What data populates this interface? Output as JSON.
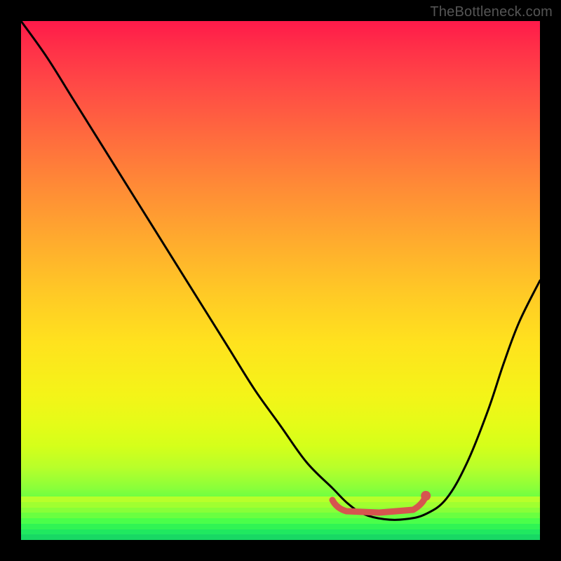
{
  "watermark": "TheBottleneck.com",
  "chart_data": {
    "type": "line",
    "title": "",
    "xlabel": "",
    "ylabel": "",
    "xlim": [
      0,
      1
    ],
    "ylim": [
      0,
      1
    ],
    "series": [
      {
        "name": "bottleneck-curve",
        "x": [
          0.0,
          0.05,
          0.1,
          0.15,
          0.2,
          0.25,
          0.3,
          0.35,
          0.4,
          0.45,
          0.5,
          0.55,
          0.6,
          0.63,
          0.66,
          0.7,
          0.74,
          0.78,
          0.82,
          0.86,
          0.9,
          0.93,
          0.96,
          1.0
        ],
        "y": [
          1.0,
          0.93,
          0.85,
          0.77,
          0.69,
          0.61,
          0.53,
          0.45,
          0.37,
          0.29,
          0.22,
          0.15,
          0.1,
          0.07,
          0.05,
          0.04,
          0.04,
          0.05,
          0.08,
          0.15,
          0.25,
          0.34,
          0.42,
          0.5
        ]
      }
    ],
    "highlight": {
      "name": "optimal-range",
      "x_range": [
        0.6,
        0.78
      ],
      "approx_y": 0.05
    },
    "background": {
      "type": "vertical-gradient",
      "stops": [
        {
          "pos": 0.0,
          "color": "#ff1a4a"
        },
        {
          "pos": 0.5,
          "color": "#ffd024"
        },
        {
          "pos": 0.8,
          "color": "#d4ff1a"
        },
        {
          "pos": 1.0,
          "color": "#18d864"
        }
      ]
    }
  }
}
